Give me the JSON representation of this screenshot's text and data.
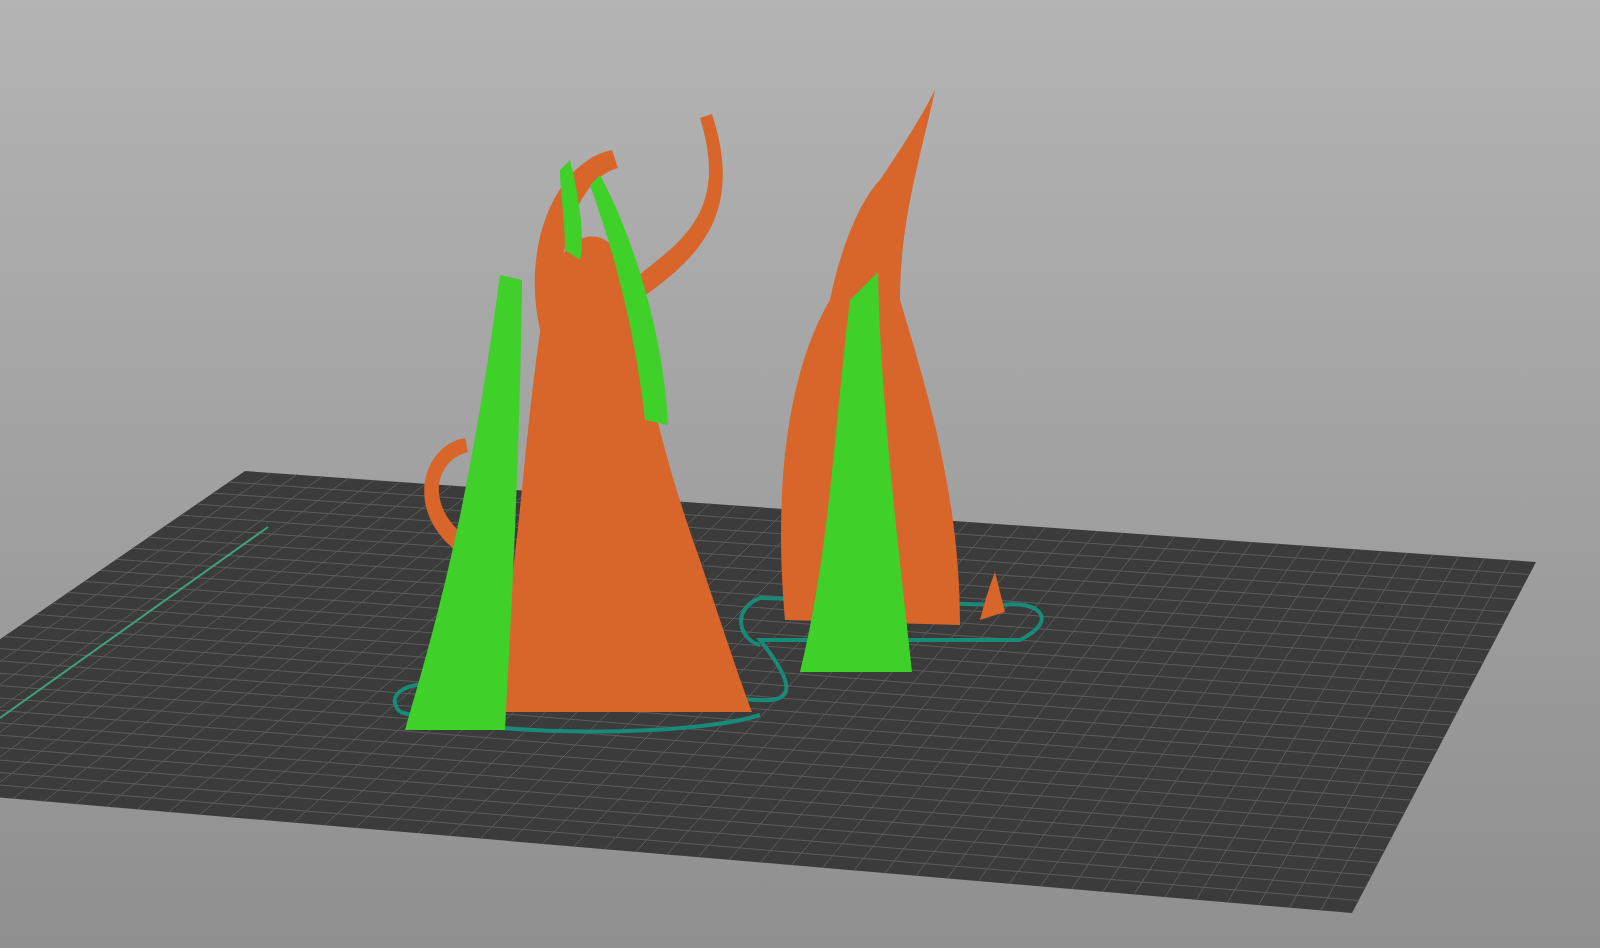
{
  "viewport": {
    "parts": [
      {
        "kind": "brim",
        "color": "#178a78"
      },
      {
        "kind": "model",
        "color": "#d8652a"
      },
      {
        "kind": "support",
        "color": "#3fd12a"
      }
    ]
  }
}
